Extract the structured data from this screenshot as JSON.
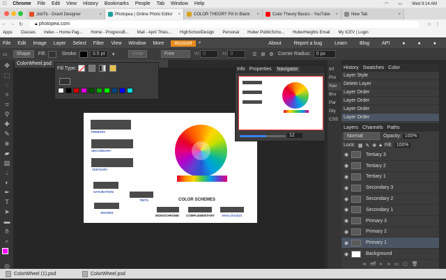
{
  "macbar": {
    "app": "Chrome",
    "menus": [
      "File",
      "Edit",
      "View",
      "History",
      "Bookmarks",
      "People",
      "Tab",
      "Window",
      "Help"
    ],
    "right": "Wed 9:14 AM"
  },
  "tabs": [
    {
      "label": "JobTb - Gravit Designer",
      "color": "#e34c26",
      "active": false
    },
    {
      "label": "Photopea | Online Photo Editor",
      "color": "#1ba09b",
      "active": true
    },
    {
      "label": "COLOR THEORY Fill In Blank",
      "color": "#d8a21e",
      "active": false
    },
    {
      "label": "Color Theory Basics - YouTube",
      "color": "#ff0000",
      "active": false
    },
    {
      "label": "New Tab",
      "color": "#888888",
      "active": false
    }
  ],
  "address": {
    "url": "photopea.com"
  },
  "bookmarks": [
    "Apps",
    "Classes",
    "Index -- Home Pag...",
    "Home - ProgressB...",
    "Mail - April Thies...",
    "HighSchoolDesign",
    "Personal",
    "Huber PublicScho...",
    "HuberHeights Email",
    "My ICEV | Login"
  ],
  "ppmenu": {
    "items": [
      "File",
      "Edit",
      "Image",
      "Layer",
      "Select",
      "Filter",
      "View",
      "Window",
      "More"
    ],
    "account": "Account",
    "right": [
      "About",
      "Report a bug",
      "Learn",
      "Blog",
      "API"
    ]
  },
  "options": {
    "shape": "Shape",
    "fill": "Fill:",
    "stroke": "Stroke:",
    "stroke_size": "0.5 pt",
    "unite": "Unite",
    "free": "Free",
    "w": "W:",
    "w_val": "0",
    "h": "H:",
    "h_val": "0",
    "corner": "Corner Radius:",
    "corner_val": "0 px"
  },
  "doctab": {
    "name": "ColorWheel.psd",
    "close": "×"
  },
  "fillpop": {
    "label": "Fill Type:"
  },
  "swatches": [
    "#ffffff",
    "#000000",
    "#cc0000",
    "#dd00dd",
    "#005500",
    "#00aa00",
    "#00ff00",
    "#004488",
    "#0000ff",
    "#00dddd"
  ],
  "navigator": {
    "tabs": [
      "Info",
      "Properties",
      "Navigator"
    ],
    "zoom": "12"
  },
  "canvas": {
    "labels": {
      "primary": "PRIMARY",
      "secondary": "SECONDARY",
      "tertiary": "TERTIARY",
      "saturation": "SATURATION",
      "tints": "TINTS",
      "shades": "SHADES",
      "schemes": "COLOR SCHEMES",
      "mono": "MONOCHROME",
      "comp": "COMPLEMENTARY",
      "analog": "ANALOGOUS"
    }
  },
  "sidecol": [
    "Inf",
    "Pro",
    "Nav",
    "Bru",
    "Par",
    "Gly",
    "CSS"
  ],
  "history": {
    "tabs": [
      "History",
      "Swatches",
      "Color"
    ],
    "items": [
      "Layer Style",
      "Delete Layer",
      "Layer Order",
      "Layer Order",
      "Layer Order",
      "Layer Order"
    ]
  },
  "layers": {
    "tabs": [
      "Layers",
      "Channels",
      "Paths"
    ],
    "blend": "Normal",
    "opacity_label": "Opacity:",
    "opacity": "100%",
    "lock": "Lock:",
    "fill_label": "Fill:",
    "fill": "100%",
    "items": [
      "Tertiary 3",
      "Tertiary 2",
      "Tertiary 1",
      "Secondary 3",
      "Secondary 2",
      "Secondary 1",
      "Primary 3",
      "Primary 2",
      "Primary 1",
      "Background"
    ],
    "selected": 8
  },
  "bottom": [
    "ColorWheel (1).psd",
    "ColorWheel.psd"
  ]
}
